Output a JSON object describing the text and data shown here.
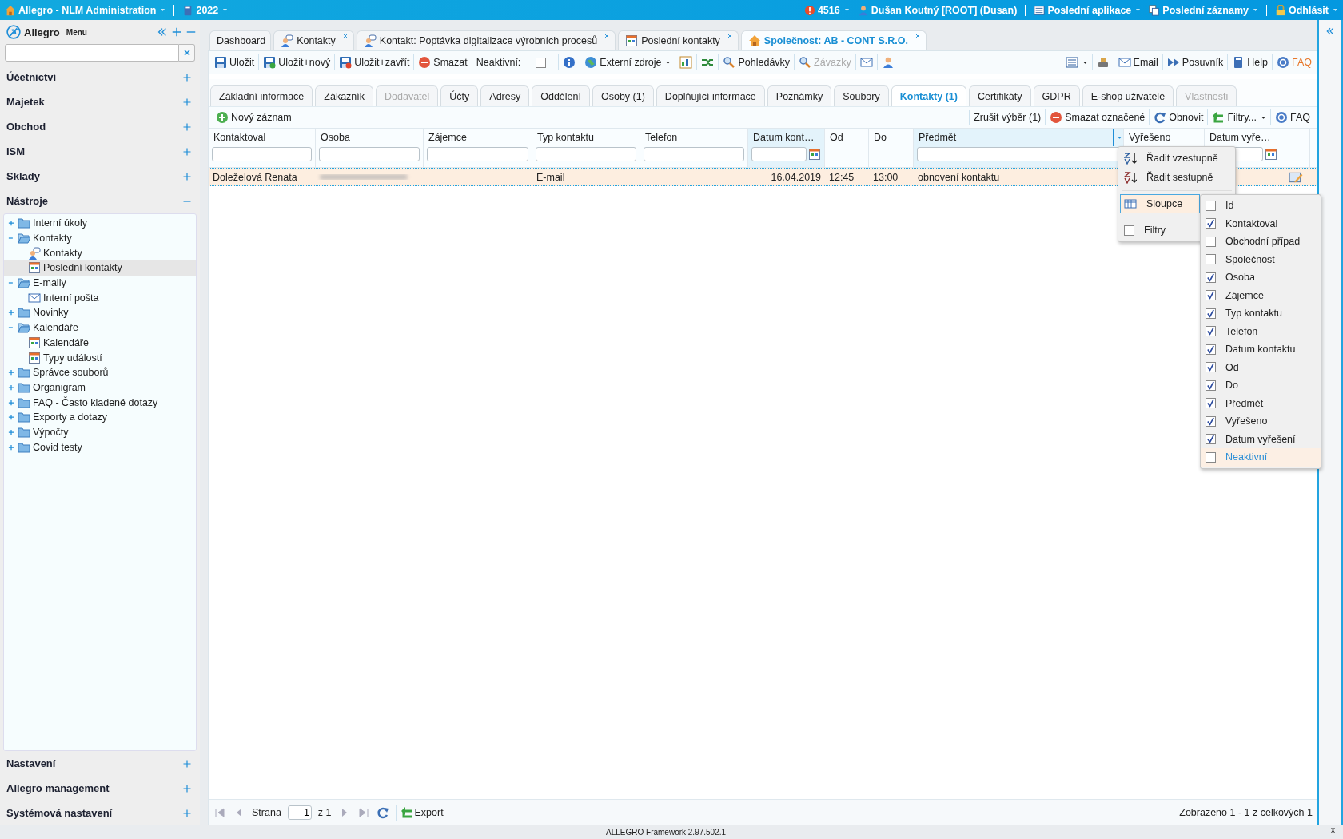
{
  "app_bar": {
    "title": "Allegro - NLM Administration",
    "year": "2022",
    "alerts": "4516",
    "user": "Dušan Koutný [ROOT] (Dusan)",
    "links": [
      {
        "label": "Poslední aplikace"
      },
      {
        "label": "Poslední záznamy"
      },
      {
        "label": "Odhlásit"
      }
    ]
  },
  "sidebar": {
    "logo": "Allegro",
    "menu_label": "Menu",
    "sections": [
      {
        "label": "Účetnictví",
        "expanded": false
      },
      {
        "label": "Majetek",
        "expanded": false
      },
      {
        "label": "Obchod",
        "expanded": false
      },
      {
        "label": "ISM",
        "expanded": false
      },
      {
        "label": "Sklady",
        "expanded": false
      },
      {
        "label": "Nástroje",
        "expanded": true
      }
    ],
    "tree": [
      {
        "kind": "folder",
        "label": "Interní úkoly",
        "expanded": false,
        "selected": false
      },
      {
        "kind": "folder",
        "label": "Kontakty",
        "expanded": true,
        "selected": false,
        "children": [
          {
            "kind": "contacts",
            "label": "Kontakty",
            "selected": false
          },
          {
            "kind": "report",
            "label": "Poslední kontakty",
            "selected": true
          }
        ]
      },
      {
        "kind": "folder",
        "label": "E-maily",
        "expanded": true,
        "selected": false,
        "children": [
          {
            "kind": "mail",
            "label": "Interní pošta",
            "selected": false
          }
        ]
      },
      {
        "kind": "folder",
        "label": "Novinky",
        "expanded": false,
        "selected": false
      },
      {
        "kind": "folder",
        "label": "Kalendáře",
        "expanded": true,
        "selected": false,
        "children": [
          {
            "kind": "calendar",
            "label": "Kalendáře",
            "selected": false
          },
          {
            "kind": "types",
            "label": "Typy událostí",
            "selected": false
          }
        ]
      },
      {
        "kind": "folder",
        "label": "Správce souborů",
        "expanded": false,
        "selected": false
      },
      {
        "kind": "folder",
        "label": "Organigram",
        "expanded": false,
        "selected": false
      },
      {
        "kind": "folder",
        "label": "FAQ - Často kladené dotazy",
        "expanded": false,
        "selected": false
      },
      {
        "kind": "folder",
        "label": "Exporty a dotazy",
        "expanded": false,
        "selected": false
      },
      {
        "kind": "folder",
        "label": "Výpočty",
        "expanded": false,
        "selected": false
      },
      {
        "kind": "folder",
        "label": "Covid testy",
        "expanded": false,
        "selected": false
      }
    ],
    "bottom_sections": [
      {
        "label": "Nastavení",
        "expanded": false
      },
      {
        "label": "Allegro management",
        "expanded": false
      },
      {
        "label": "Systémová nastavení",
        "expanded": false
      }
    ]
  },
  "doc_tabs": [
    {
      "label": "Dashboard",
      "closable": false,
      "selected": false
    },
    {
      "label": "Kontakty",
      "closable": true,
      "selected": false
    },
    {
      "label": "Kontakt: Poptávka digitalizace výrobních procesů",
      "closable": true,
      "selected": false
    },
    {
      "label": "Poslední kontakty",
      "closable": true,
      "selected": false
    },
    {
      "label": "Společnost: AB - CONT S.R.O.",
      "closable": true,
      "selected": true
    }
  ],
  "toolbar": {
    "left": [
      {
        "kind": "button",
        "label": "Uložit",
        "disabled": false
      },
      {
        "kind": "button",
        "label": "Uložit+nový",
        "disabled": false
      },
      {
        "kind": "button",
        "label": "Uložit+zavřít",
        "disabled": false
      },
      {
        "kind": "button",
        "label": "Smazat",
        "disabled": false
      },
      {
        "kind": "checkbox",
        "label": "Neaktivní:",
        "checked": false
      },
      {
        "kind": "icon"
      },
      {
        "kind": "button",
        "label": "Externí zdroje",
        "disabled": false,
        "dropdown": true
      },
      {
        "kind": "icon"
      },
      {
        "kind": "icon"
      },
      {
        "kind": "button",
        "label": "Pohledávky",
        "disabled": false
      },
      {
        "kind": "button",
        "label": "Závazky",
        "disabled": true
      },
      {
        "kind": "icon"
      },
      {
        "kind": "icon"
      }
    ],
    "right": [
      {
        "kind": "icon",
        "dropdown": true
      },
      {
        "kind": "icon"
      },
      {
        "kind": "button",
        "label": "Email",
        "disabled": false
      },
      {
        "kind": "button",
        "label": "Posuvník",
        "disabled": false
      },
      {
        "kind": "button",
        "label": "Help",
        "disabled": false
      },
      {
        "kind": "link",
        "label": "FAQ"
      }
    ]
  },
  "subtabs": [
    {
      "label": "Základní informace",
      "selected": false,
      "disabled": false
    },
    {
      "label": "Zákazník",
      "selected": false,
      "disabled": false
    },
    {
      "label": "Dodavatel",
      "selected": false,
      "disabled": true
    },
    {
      "label": "Účty",
      "selected": false,
      "disabled": false
    },
    {
      "label": "Adresy",
      "selected": false,
      "disabled": false
    },
    {
      "label": "Oddělení",
      "selected": false,
      "disabled": false
    },
    {
      "label": "Osoby (1)",
      "selected": false,
      "disabled": false
    },
    {
      "label": "Doplňující informace",
      "selected": false,
      "disabled": false
    },
    {
      "label": "Poznámky",
      "selected": false,
      "disabled": false
    },
    {
      "label": "Soubory",
      "selected": false,
      "disabled": false
    },
    {
      "label": "Kontakty (1)",
      "selected": true,
      "disabled": false
    },
    {
      "label": "Certifikáty",
      "selected": false,
      "disabled": false
    },
    {
      "label": "GDPR",
      "selected": false,
      "disabled": false
    },
    {
      "label": "E-shop uživatelé",
      "selected": false,
      "disabled": false
    },
    {
      "label": "Vlastnosti",
      "selected": false,
      "disabled": true
    }
  ],
  "grid_toolbar": {
    "left": [
      {
        "label": "Nový záznam"
      }
    ],
    "right": [
      {
        "label": "Zrušit výběr (1)"
      },
      {
        "label": "Smazat označené"
      },
      {
        "label": "Obnovit"
      },
      {
        "label": "Filtry...",
        "dropdown": true
      },
      {
        "label": "FAQ"
      }
    ]
  },
  "grid": {
    "columns": [
      {
        "label": "Kontaktoval",
        "kind": "text",
        "highlighted": false
      },
      {
        "label": "Osoba",
        "kind": "text",
        "highlighted": false
      },
      {
        "label": "Zájemce",
        "kind": "text",
        "highlighted": false
      },
      {
        "label": "Typ kontaktu",
        "kind": "text",
        "highlighted": false
      },
      {
        "label": "Telefon",
        "kind": "text",
        "highlighted": false
      },
      {
        "label": "Datum kont…",
        "kind": "date",
        "highlighted": true
      },
      {
        "label": "Od",
        "kind": "plain",
        "highlighted": false
      },
      {
        "label": "Do",
        "kind": "plain",
        "highlighted": false
      },
      {
        "label": "Předmět",
        "kind": "text",
        "highlighted": true,
        "menu_open": true
      },
      {
        "label": "Vyřešeno",
        "kind": "plain",
        "highlighted": false
      },
      {
        "label": "Datum vyře…",
        "kind": "date",
        "highlighted": false
      }
    ],
    "rows": [
      {
        "selected": true,
        "cells": [
          {
            "kind": "text",
            "text": "Doleželová Renata"
          },
          {
            "kind": "redacted"
          },
          {
            "kind": "empty"
          },
          {
            "kind": "text",
            "text": "E-mail"
          },
          {
            "kind": "empty"
          },
          {
            "kind": "text",
            "text": "16.04.2019"
          },
          {
            "kind": "text",
            "text": "12:45"
          },
          {
            "kind": "text",
            "text": "13:00"
          },
          {
            "kind": "text",
            "text": "obnovení kontaktu"
          },
          {
            "kind": "empty"
          },
          {
            "kind": "empty"
          },
          {
            "kind": "edit"
          }
        ]
      }
    ]
  },
  "column_menu": {
    "items": [
      {
        "kind": "sort",
        "label": "Řadit vzestupně"
      },
      {
        "kind": "sort",
        "label": "Řadit sestupně"
      },
      {
        "kind": "submenu",
        "label": "Sloupce",
        "selected": true
      },
      {
        "kind": "checkbox",
        "label": "Filtry",
        "checked": false
      }
    ],
    "columns_submenu": [
      {
        "label": "Id",
        "checked": false,
        "selected": false
      },
      {
        "label": "Kontaktoval",
        "checked": true,
        "selected": false
      },
      {
        "label": "Obchodní případ",
        "checked": false,
        "selected": false
      },
      {
        "label": "Společnost",
        "checked": false,
        "selected": false
      },
      {
        "label": "Osoba",
        "checked": true,
        "selected": false
      },
      {
        "label": "Zájemce",
        "checked": true,
        "selected": false
      },
      {
        "label": "Typ kontaktu",
        "checked": true,
        "selected": false
      },
      {
        "label": "Telefon",
        "checked": true,
        "selected": false
      },
      {
        "label": "Datum kontaktu",
        "checked": true,
        "selected": false
      },
      {
        "label": "Od",
        "checked": true,
        "selected": false
      },
      {
        "label": "Do",
        "checked": true,
        "selected": false
      },
      {
        "label": "Předmět",
        "checked": true,
        "selected": false
      },
      {
        "label": "Vyřešeno",
        "checked": true,
        "selected": false
      },
      {
        "label": "Datum vyřešení",
        "checked": true,
        "selected": false
      },
      {
        "label": "Neaktivní",
        "checked": false,
        "selected": true
      }
    ]
  },
  "pager": {
    "page_label": "Strana",
    "page": "1",
    "of": "z 1",
    "export": "Export",
    "summary": "Zobrazeno 1 - 1 z celkových 1"
  },
  "footer": {
    "text": "ALLEGRO Framework 2.97.502.1",
    "close": "x"
  }
}
